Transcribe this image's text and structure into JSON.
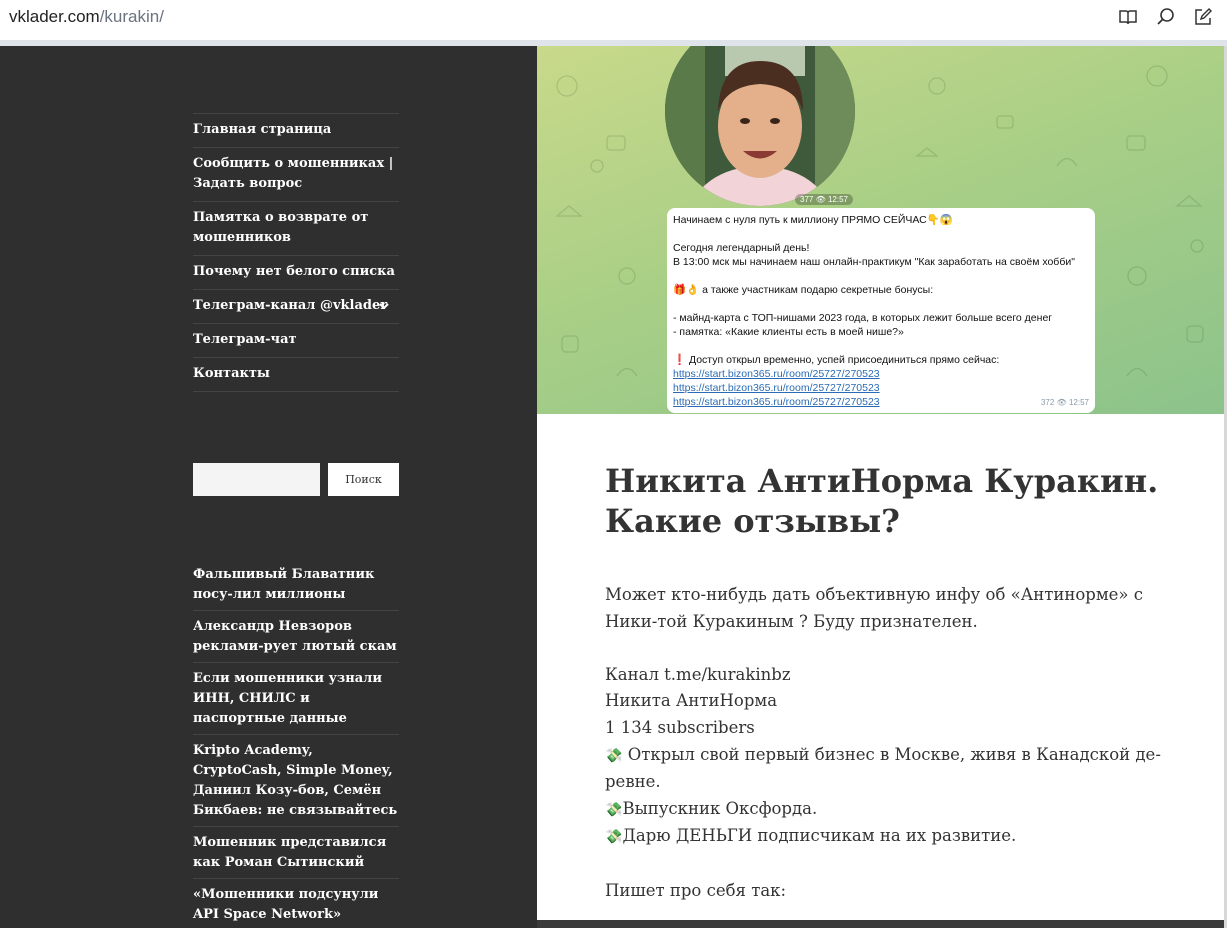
{
  "browser": {
    "url_domain": "vklader.com",
    "url_path": "/kurakin/",
    "icons": [
      "reader-mode-icon",
      "search-page-icon",
      "edit-note-icon"
    ]
  },
  "sidebar": {
    "menu": [
      {
        "label": "Главная страница"
      },
      {
        "label": "Сообщить о мошенниках | Задать вопрос"
      },
      {
        "label": "Памятка о возврате от мошенников"
      },
      {
        "label": "Почему нет белого списка"
      },
      {
        "label": "Телеграм-канал @vklader",
        "has_submenu": true
      },
      {
        "label": "Телеграм-чат"
      },
      {
        "label": "Контакты"
      }
    ],
    "search": {
      "placeholder": "",
      "button_label": "Поиск"
    },
    "recent_posts": [
      {
        "label": "Фальшивый Блаватник посу-лил миллионы"
      },
      {
        "label": "Александр Невзоров реклами-рует лютый скам"
      },
      {
        "label": "Если мошенники узнали ИНН, СНИЛС и паспортные данные"
      },
      {
        "label": "Kripto Academy, CryptoCash, Simple Money, Даниил Козу-бов, Семён Бикбаев: не связывайтесь"
      },
      {
        "label": "Мошенник представился как Роман Сытинский"
      },
      {
        "label": "«Мошенники подсунули API Space Network»"
      }
    ]
  },
  "hero": {
    "video_views": "377",
    "video_time": "12:57",
    "message_lines": [
      "Начинаем с нуля путь к миллиону ПРЯМО СЕЙЧАС👇😱",
      "Сегодня легендарный день!",
      "В 13:00 мск мы начинаем наш онлайн-практикум \"Как заработать на своём хобби\"",
      "🎁👌 а также участникам подарю секретные бонусы:",
      "- майнд-карта с ТОП-нишами 2023 года, в которых лежит больше всего денег",
      "- памятка: «Какие клиенты есть в моей нише?»",
      "❗ Доступ открыл временно, успей присоединиться прямо сейчас:"
    ],
    "message_links": [
      "https://start.bizon365.ru/room/25727/270523",
      "https://start.bizon365.ru/room/25727/270523",
      "https://start.bizon365.ru/room/25727/270523"
    ],
    "message_views": "372",
    "message_time": "12:57"
  },
  "article": {
    "title": "Никита АнтиНорма Куракин. Какие отзывы?",
    "intro": "Может кто-нибудь дать объективную инфу об «Антинорме» с Ники-той Куракиным ? Буду признателен.",
    "channel_lines": [
      "Канал t.me/kurakinbz",
      "Никита АнтиНорма",
      "1 134 subscribers"
    ],
    "bullets": [
      "Открыл свой первый бизнес в Москве, живя в Канадской де-ревне.",
      "Выпускник Оксфорда.",
      "Дарю ДЕНЬГИ подписчикам на их развитие."
    ],
    "bullet_emoji": "💸",
    "outro": "Пишет про себя так:"
  }
}
